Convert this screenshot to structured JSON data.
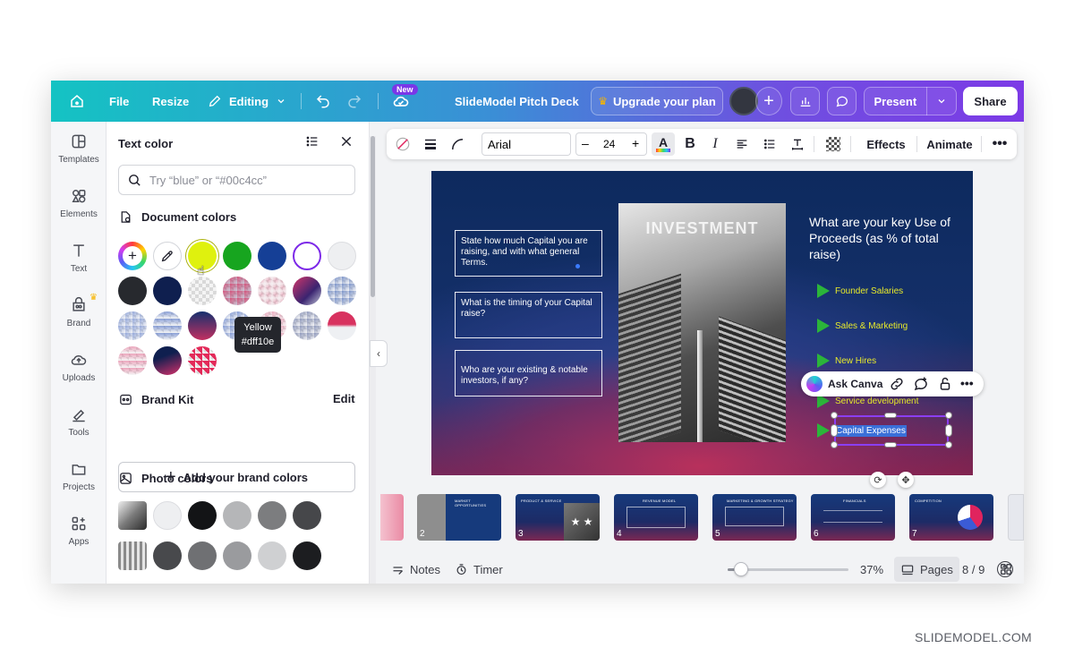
{
  "topbar": {
    "file": "File",
    "resize": "Resize",
    "editing": "Editing",
    "new_badge": "New",
    "doc_title": "SlideModel Pitch Deck",
    "upgrade": "Upgrade your plan",
    "present": "Present",
    "share": "Share"
  },
  "rail": [
    {
      "label": "Templates",
      "icon": "templates-icon"
    },
    {
      "label": "Elements",
      "icon": "elements-icon"
    },
    {
      "label": "Text",
      "icon": "text-icon"
    },
    {
      "label": "Brand",
      "icon": "brand-icon"
    },
    {
      "label": "Uploads",
      "icon": "uploads-icon"
    },
    {
      "label": "Tools",
      "icon": "tools-icon"
    },
    {
      "label": "Projects",
      "icon": "projects-icon"
    },
    {
      "label": "Apps",
      "icon": "apps-icon"
    }
  ],
  "panel": {
    "title": "Text color",
    "search_placeholder": "Try “blue” or “#00c4cc”",
    "document_colors": "Document colors",
    "tooltip_name": "Yellow",
    "tooltip_hex": "#dff10e",
    "brand_kit": "Brand Kit",
    "edit": "Edit",
    "add_brand": "Add your brand colors",
    "photo_colors": "Photo colors"
  },
  "colors": {
    "yellow": "#dff10e",
    "green": "#17a51f",
    "blue": "#153f96",
    "purple_ring": "#7d2ae8",
    "accent": "#8b3ef2"
  },
  "toolbar": {
    "font": "Arial",
    "size": "24",
    "effects": "Effects",
    "animate": "Animate"
  },
  "slide": {
    "box1": "State how much Capital you are raising, and with what general Terms.",
    "box2": "What is the timing of your Capital raise?",
    "box3": "Who are your existing & notable investors, if any?",
    "photo_caption": "INVESTMENT",
    "heading": "What are your key Use of Proceeds (as % of total raise)",
    "bullets": [
      "Founder Salaries",
      "Sales & Marketing",
      "New Hires",
      "Service development",
      "Capital Expenses"
    ]
  },
  "ask_canva": "Ask Canva",
  "thumbnails": [
    {
      "num": "2",
      "title": "MARKET OPPORTUNITIES"
    },
    {
      "num": "3",
      "title": "PRODUCT & SERVICE"
    },
    {
      "num": "4",
      "title": "REVENUE MODEL"
    },
    {
      "num": "5",
      "title": "MARKETING & GROWTH STRATEGY"
    },
    {
      "num": "6",
      "title": "FINANCIALS"
    },
    {
      "num": "7",
      "title": "COMPETITION"
    }
  ],
  "bottombar": {
    "notes": "Notes",
    "timer": "Timer",
    "zoom": 37,
    "zoom_label": "37%",
    "pages": "Pages",
    "page_count": "8 / 9"
  },
  "watermark": "SLIDEMODEL.COM"
}
